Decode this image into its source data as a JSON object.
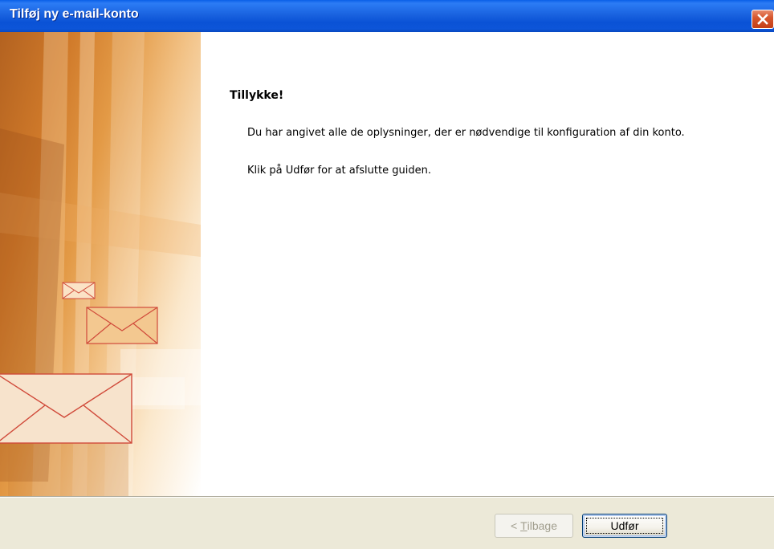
{
  "window": {
    "title": "Tilføj ny e-mail-konto"
  },
  "content": {
    "heading": "Tillykke!",
    "message1": "Du har angivet alle de oplysninger, der er nødvendige til konfiguration af din konto.",
    "message2": "Klik på Udfør for at afslutte guiden."
  },
  "buttons": {
    "back": {
      "prefix": "< ",
      "mnemonic": "T",
      "rest": "ilbage",
      "enabled": false
    },
    "finish": {
      "label": "Udfør"
    }
  },
  "icons": {
    "close": "close-icon",
    "envelope": "envelope-icon"
  },
  "colors": {
    "titlebar": "#0a52d6",
    "close": "#d7572e",
    "banner_accent": "#d07a2a",
    "footer": "#ece9d8"
  }
}
